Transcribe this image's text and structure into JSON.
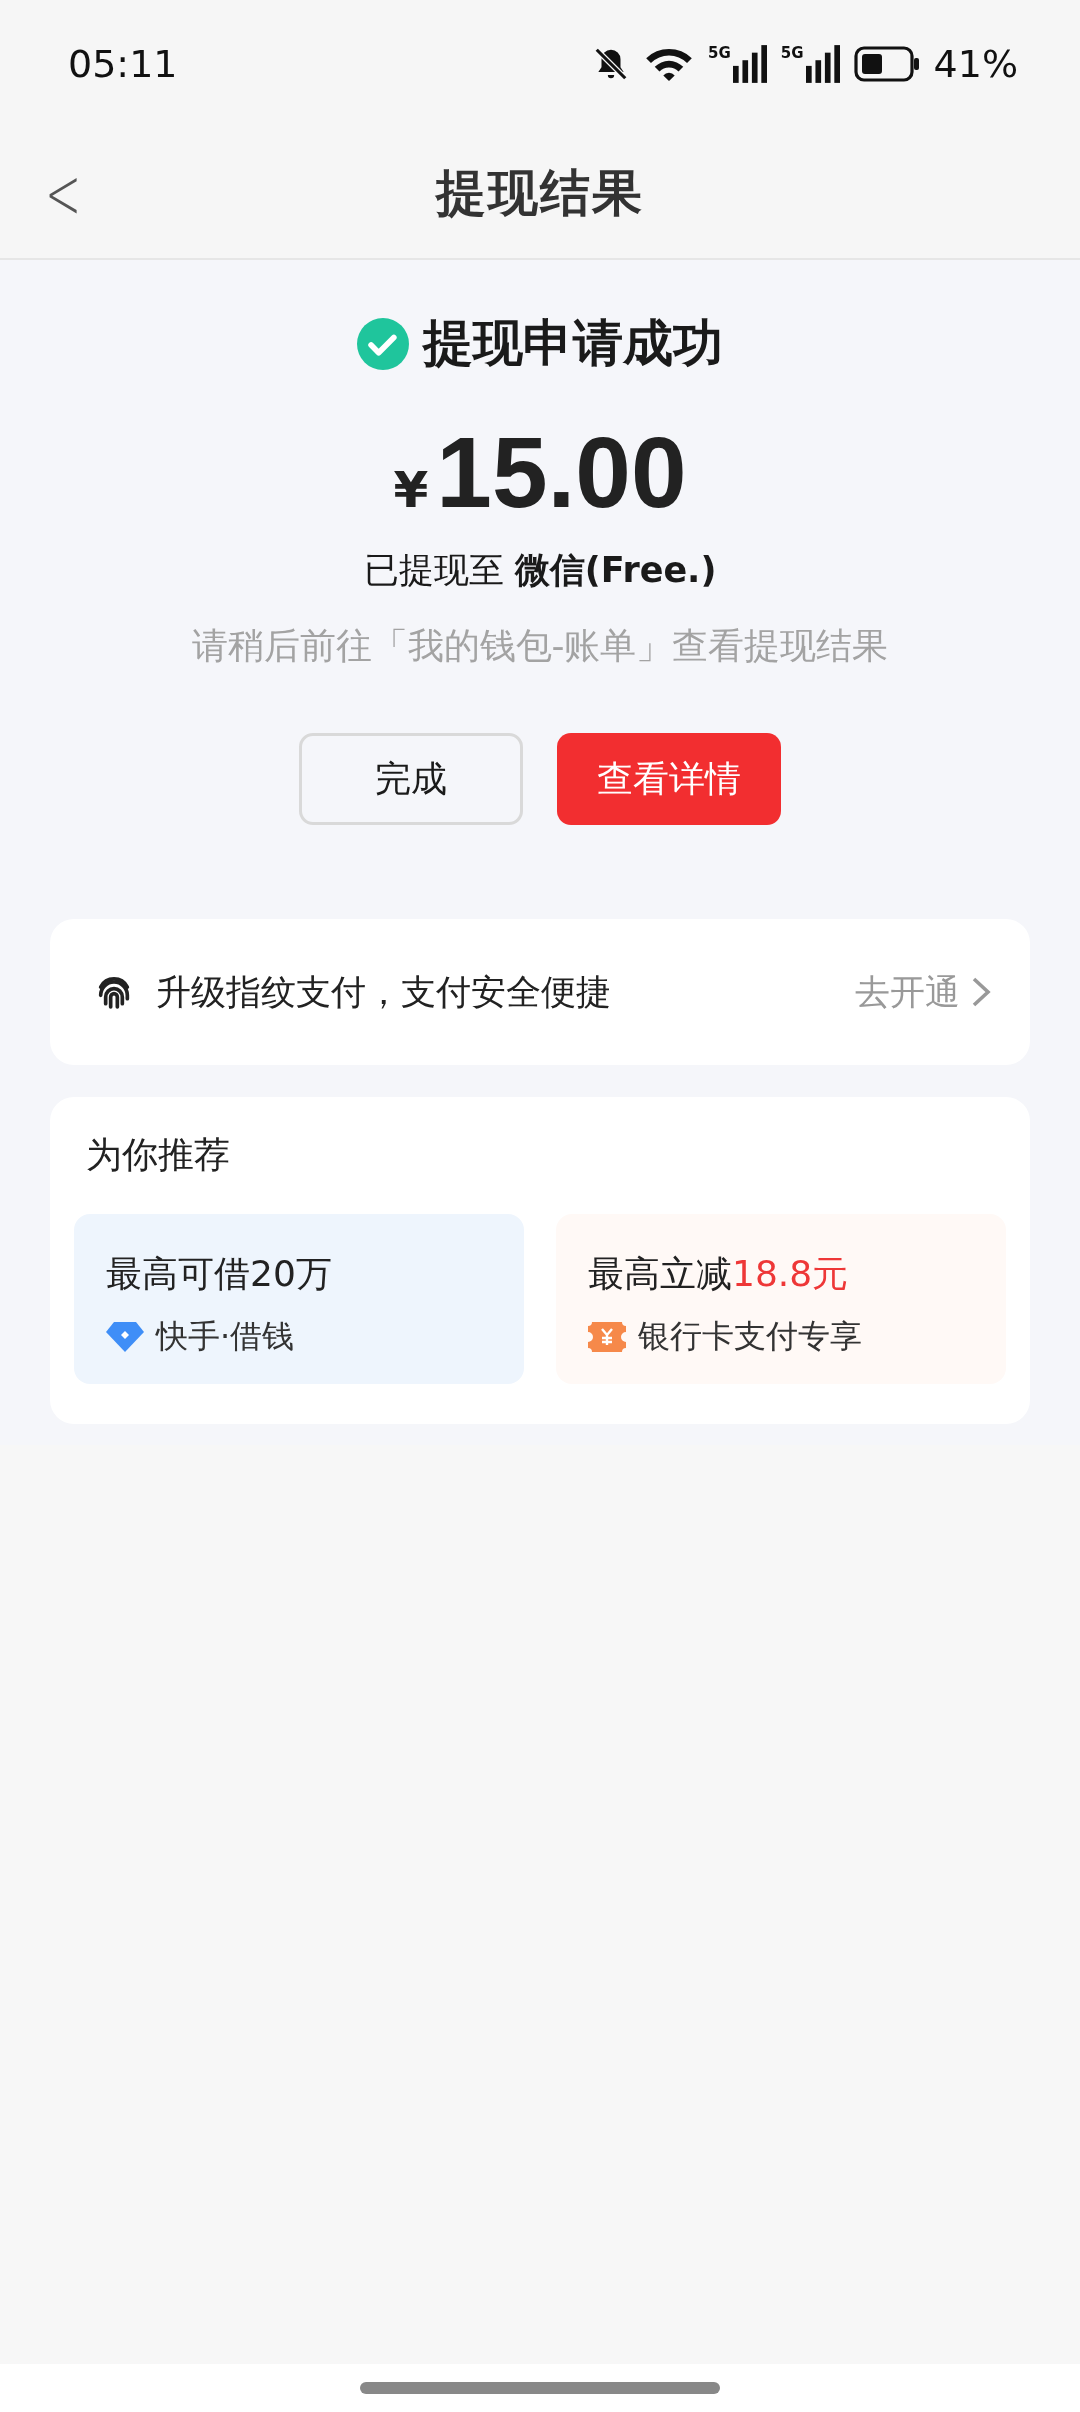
{
  "status_bar": {
    "time": "05:11",
    "signals": [
      {
        "label": "5G"
      },
      {
        "label": "5G"
      }
    ],
    "battery_text": "41%"
  },
  "header": {
    "back": "<",
    "title": "提现结果"
  },
  "result": {
    "title": "提现申请成功",
    "currency": "¥",
    "amount": "15.00",
    "destination": "已提现至 **微信(Free.)**",
    "hint": "请稍后前往「我的钱包-账单」查看提现结果"
  },
  "buttons": [
    {
      "label": "完成",
      "kind": "secondary"
    },
    {
      "label": "查看详情",
      "kind": "primary"
    }
  ],
  "fingerprint_card": {
    "text": "升级指纹支付，支付安全便捷",
    "action": "去开通"
  },
  "recommend": {
    "title": "为你推荐",
    "items": [
      {
        "kind": "loan",
        "title": "最高可借20万",
        "subtitle": "快手·借钱"
      },
      {
        "kind": "coupon",
        "title": "最高立减",
        "highlight": "18.8元",
        "subtitle": "银行卡支付专享"
      }
    ]
  }
}
